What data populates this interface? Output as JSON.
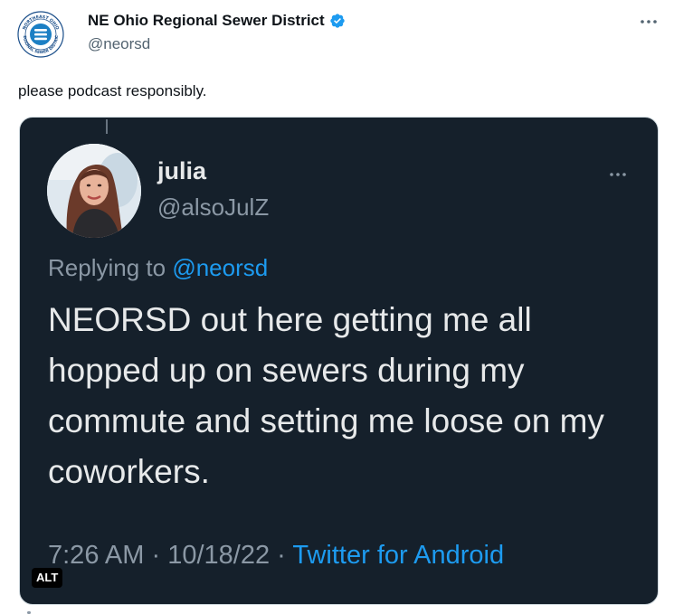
{
  "post": {
    "author": {
      "display_name": "NE Ohio Regional Sewer District",
      "handle": "@neorsd",
      "verified": true,
      "avatar_icon": "neorsd-logo-icon",
      "logo_text_top": "NORTHEAST OHIO",
      "logo_text_bottom": "REGIONAL SEWER DISTRICT"
    },
    "text": "please podcast responsibly.",
    "more_icon": "more-horizontal-icon"
  },
  "media": {
    "alt_label": "ALT",
    "quoted": {
      "display_name": "julia",
      "handle": "@alsoJulZ",
      "replying_prefix": "Replying to",
      "replying_to": "@neorsd",
      "text": "NEORSD out here getting me all hopped up on sewers during my commute and setting me loose on my coworkers.",
      "time": "7:26 AM",
      "separator": "·",
      "date": "10/18/22",
      "source": "Twitter for Android"
    }
  },
  "colors": {
    "link_blue": "#1d9bf0",
    "dark_bg": "#15202b",
    "secondary_text": "#536471"
  }
}
